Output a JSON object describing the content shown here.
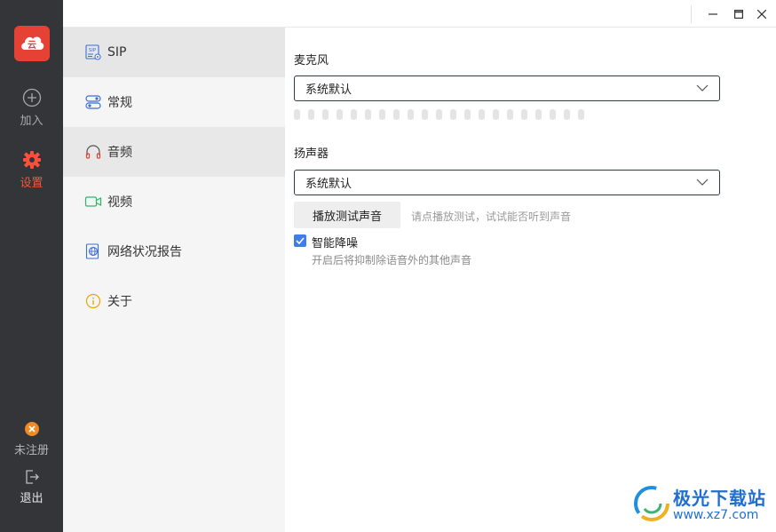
{
  "rail": {
    "join_label": "加入",
    "settings_label": "设置",
    "unregistered_label": "未注册",
    "logout_label": "退出",
    "accent": "#ff4f3b",
    "logo_icon": "cloud-logo-icon"
  },
  "window": {
    "controls": [
      "minimize",
      "maximize",
      "close"
    ]
  },
  "nav": {
    "items": [
      {
        "label": "SIP",
        "icon": "sip-icon",
        "active": true
      },
      {
        "label": "常规",
        "icon": "general-toggle-icon"
      },
      {
        "label": "音频",
        "icon": "headphones-icon"
      },
      {
        "label": "视频",
        "icon": "video-camera-icon"
      },
      {
        "label": "网络状况报告",
        "icon": "network-globe-icon"
      },
      {
        "label": "关于",
        "icon": "info-icon"
      }
    ]
  },
  "audio": {
    "mic_title": "麦克风",
    "mic_selected": "系统默认",
    "speaker_title": "扬声器",
    "speaker_selected": "系统默认",
    "test_button": "播放测试声音",
    "test_hint": "请点播放测试，试试能否听到声音",
    "noise_reduction_label": "智能降噪",
    "noise_reduction_checked": true,
    "noise_reduction_desc": "开启后将抑制除语音外的其他声音",
    "mic_level": 0
  },
  "watermark": {
    "name": "极光下载站",
    "url": "www.xz7.com"
  }
}
